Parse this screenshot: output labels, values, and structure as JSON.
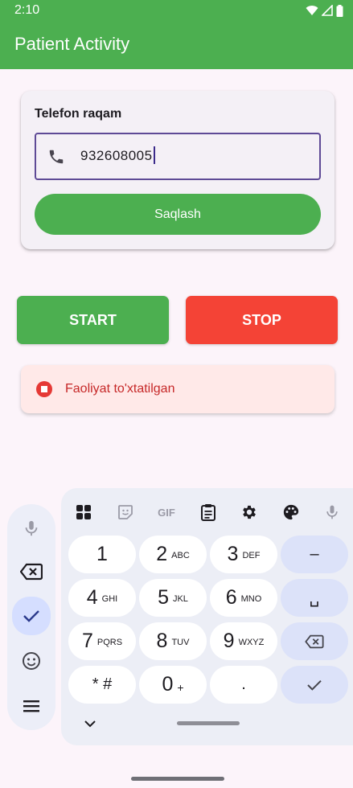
{
  "status_bar": {
    "time": "2:10",
    "icons": [
      "wifi-icon",
      "signal-icon",
      "battery-icon"
    ]
  },
  "app_bar": {
    "title": "Patient Activity"
  },
  "phone_card": {
    "label": "Telefon raqam",
    "field": {
      "icon": "phone-icon",
      "value": "932608005"
    },
    "save_label": "Saqlash"
  },
  "controls": {
    "start_label": "START",
    "stop_label": "STOP"
  },
  "activity_status": {
    "icon": "stop-circle-icon",
    "text": "Faoliyat to'xtatilgan"
  },
  "keyboard": {
    "toolbar": {
      "items": [
        "apps-grid-icon",
        "sticker-icon",
        "gif",
        "clipboard-icon",
        "settings-icon",
        "palette-icon",
        "mic-icon"
      ],
      "gif_label": "GIF"
    },
    "rows": [
      [
        {
          "main": "1",
          "sub": ""
        },
        {
          "main": "2",
          "sub": "ABC"
        },
        {
          "main": "3",
          "sub": "DEF"
        },
        {
          "main": "–",
          "sub": "",
          "fn": true
        }
      ],
      [
        {
          "main": "4",
          "sub": "GHI"
        },
        {
          "main": "5",
          "sub": "JKL"
        },
        {
          "main": "6",
          "sub": "MNO"
        },
        {
          "main": "␣",
          "sub": "",
          "fn": true
        }
      ],
      [
        {
          "main": "7",
          "sub": "PQRS"
        },
        {
          "main": "8",
          "sub": "TUV"
        },
        {
          "main": "9",
          "sub": "WXYZ"
        },
        {
          "main": "",
          "icon": "backspace-icon",
          "fn": true
        }
      ],
      [
        {
          "main": "* #",
          "sub": ""
        },
        {
          "main": "0",
          "sub": "+"
        },
        {
          "main": ".",
          "sub": ""
        },
        {
          "main": "",
          "icon": "check-icon",
          "fn": true
        }
      ]
    ]
  },
  "side_panel": {
    "items": [
      "mic-icon",
      "backspace-icon",
      "check-icon",
      "emoji-icon",
      "menu-icon"
    ],
    "active_item": "check-icon"
  },
  "colors": {
    "primary_green": "#4caf50",
    "stop_red": "#f44336",
    "status_text_red": "#c62828",
    "field_border": "#5e4a96",
    "keyboard_fn_key": "#dce2f9"
  }
}
